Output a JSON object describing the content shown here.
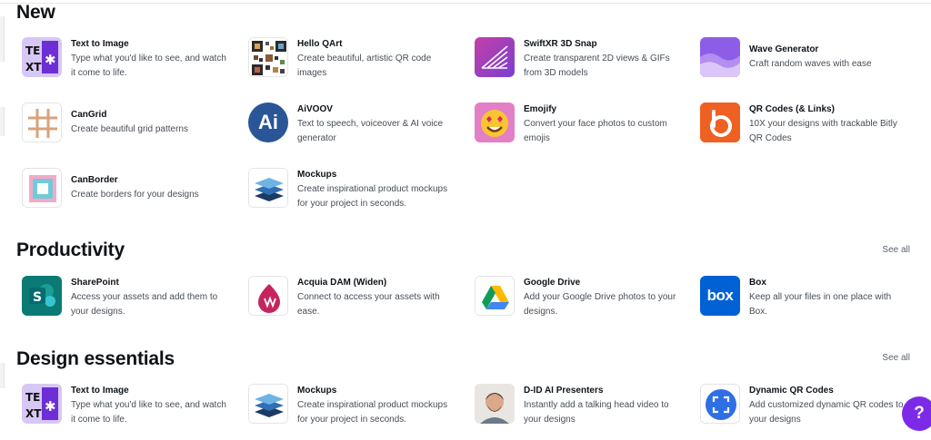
{
  "sections": [
    {
      "title": "New",
      "see_all": "",
      "apps": [
        {
          "name": "Text to Image",
          "desc": "Type what you'd like to see, and watch it come to life.",
          "icon": "text-to-image-icon"
        },
        {
          "name": "Hello QArt",
          "desc": "Create beautiful, artistic QR code images",
          "icon": "qr-art-icon"
        },
        {
          "name": "SwiftXR 3D Snap",
          "desc": "Create transparent 2D views & GIFs from 3D models",
          "icon": "swiftxr-icon"
        },
        {
          "name": "Wave Generator",
          "desc": "Craft random waves with ease",
          "icon": "wave-icon"
        },
        {
          "name": "CanGrid",
          "desc": "Create beautiful grid patterns",
          "icon": "grid-icon"
        },
        {
          "name": "AiVOOV",
          "desc": "Text to speech, voiceover & AI voice generator",
          "icon": "aivoov-icon"
        },
        {
          "name": "Emojify",
          "desc": "Convert your face photos to custom emojis",
          "icon": "emoji-icon"
        },
        {
          "name": "QR Codes (& Links)",
          "desc": "10X your designs with trackable Bitly QR Codes",
          "icon": "bitly-icon"
        },
        {
          "name": "CanBorder",
          "desc": "Create borders for your designs",
          "icon": "border-icon"
        },
        {
          "name": "Mockups",
          "desc": "Create inspirational product mockups for your project in seconds.",
          "icon": "mockups-icon"
        }
      ]
    },
    {
      "title": "Productivity",
      "see_all": "See all",
      "apps": [
        {
          "name": "SharePoint",
          "desc": "Access your assets and add them to your designs.",
          "icon": "sharepoint-icon"
        },
        {
          "name": "Acquia DAM (Widen)",
          "desc": "Connect to access your assets with ease.",
          "icon": "acquia-icon"
        },
        {
          "name": "Google Drive",
          "desc": "Add your Google Drive photos to your designs.",
          "icon": "google-drive-icon"
        },
        {
          "name": "Box",
          "desc": "Keep all your files in one place with Box.",
          "icon": "box-icon"
        }
      ]
    },
    {
      "title": "Design essentials",
      "see_all": "See all",
      "apps": [
        {
          "name": "Text to Image",
          "desc": "Type what you'd like to see, and watch it come to life.",
          "icon": "text-to-image-icon"
        },
        {
          "name": "Mockups",
          "desc": "Create inspirational product mockups for your project in seconds.",
          "icon": "mockups-icon"
        },
        {
          "name": "D-ID AI Presenters",
          "desc": "Instantly add a talking head video to your designs",
          "icon": "presenter-icon"
        },
        {
          "name": "Dynamic QR Codes",
          "desc": "Add customized dynamic QR codes to your designs",
          "icon": "dynamic-qr-icon"
        }
      ]
    }
  ],
  "help": {
    "label": "?"
  },
  "icon_text": {
    "aivoov": "Ai",
    "box": "box"
  },
  "colors": {
    "accent": "#7d2ae8",
    "sharepoint": "#0b7a75",
    "aivoov": "#2a5596",
    "bitly": "#ee6123",
    "box": "#0061d5",
    "acquia": "#c4255e"
  }
}
